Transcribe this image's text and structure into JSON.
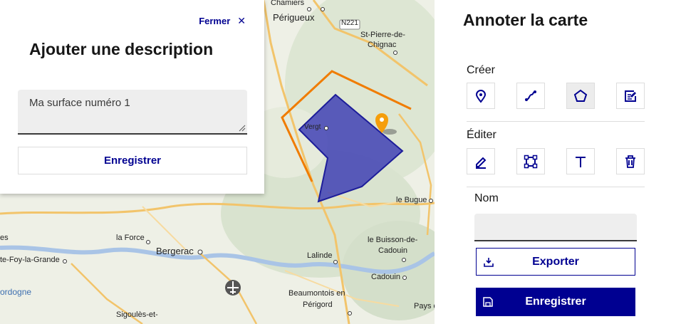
{
  "colors": {
    "accent": "#000091",
    "polygon_fill": "#2b2bb0",
    "line": "#f07c00",
    "marker": "#f59e0b"
  },
  "map": {
    "places": [
      {
        "label": "Chamiers"
      },
      {
        "label": "Périgueux"
      },
      {
        "label": "N221"
      },
      {
        "label": "St-Pierre-de-"
      },
      {
        "label": "Chignac"
      },
      {
        "label": "Vergt"
      },
      {
        "label": "le Bugue"
      },
      {
        "label": "la Force"
      },
      {
        "label": "Bergerac"
      },
      {
        "label": "le Buisson-de-"
      },
      {
        "label": "Cadouin"
      },
      {
        "label": "Lalinde"
      },
      {
        "label": "Cadouin"
      },
      {
        "label": "es"
      },
      {
        "label": "te-Foy-la-Grande"
      },
      {
        "label": "ordogne"
      },
      {
        "label": "Beaumontois en"
      },
      {
        "label": "Périgord"
      },
      {
        "label": "Sigoulès-et-"
      },
      {
        "label": "Pays de"
      }
    ],
    "airport_icon": "airport-icon"
  },
  "popup": {
    "close_label": "Fermer",
    "close_icon": "close-icon",
    "title": "Ajouter une description",
    "description_value": "Ma surface numéro 1",
    "save_label": "Enregistrer"
  },
  "panel": {
    "title": "Annoter la carte",
    "create_label": "Créer",
    "create_tools": [
      {
        "icon": "point-marker-icon"
      },
      {
        "icon": "line-icon"
      },
      {
        "icon": "polygon-icon",
        "active": true
      },
      {
        "icon": "text-note-icon"
      }
    ],
    "edit_label": "Éditer",
    "edit_tools": [
      {
        "icon": "pencil-icon"
      },
      {
        "icon": "transform-icon"
      },
      {
        "icon": "text-icon"
      },
      {
        "icon": "trash-icon"
      }
    ],
    "name_label": "Nom",
    "name_value": "",
    "export_label": "Exporter",
    "save_label": "Enregistrer"
  }
}
